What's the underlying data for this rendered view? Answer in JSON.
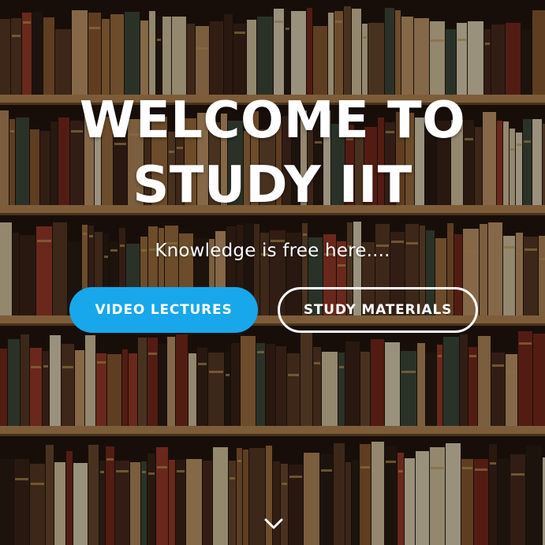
{
  "hero": {
    "title": "WELCOME TO STUDY IIT",
    "subtitle": "Knowledge is free here....",
    "background_icon": "bookshelf-photo",
    "accent_color": "#18a7eb",
    "buttons": {
      "primary_label": "VIDEO LECTURES",
      "secondary_label": "STUDY MATERIALS"
    },
    "scroll_icon": "chevron-down-icon"
  }
}
